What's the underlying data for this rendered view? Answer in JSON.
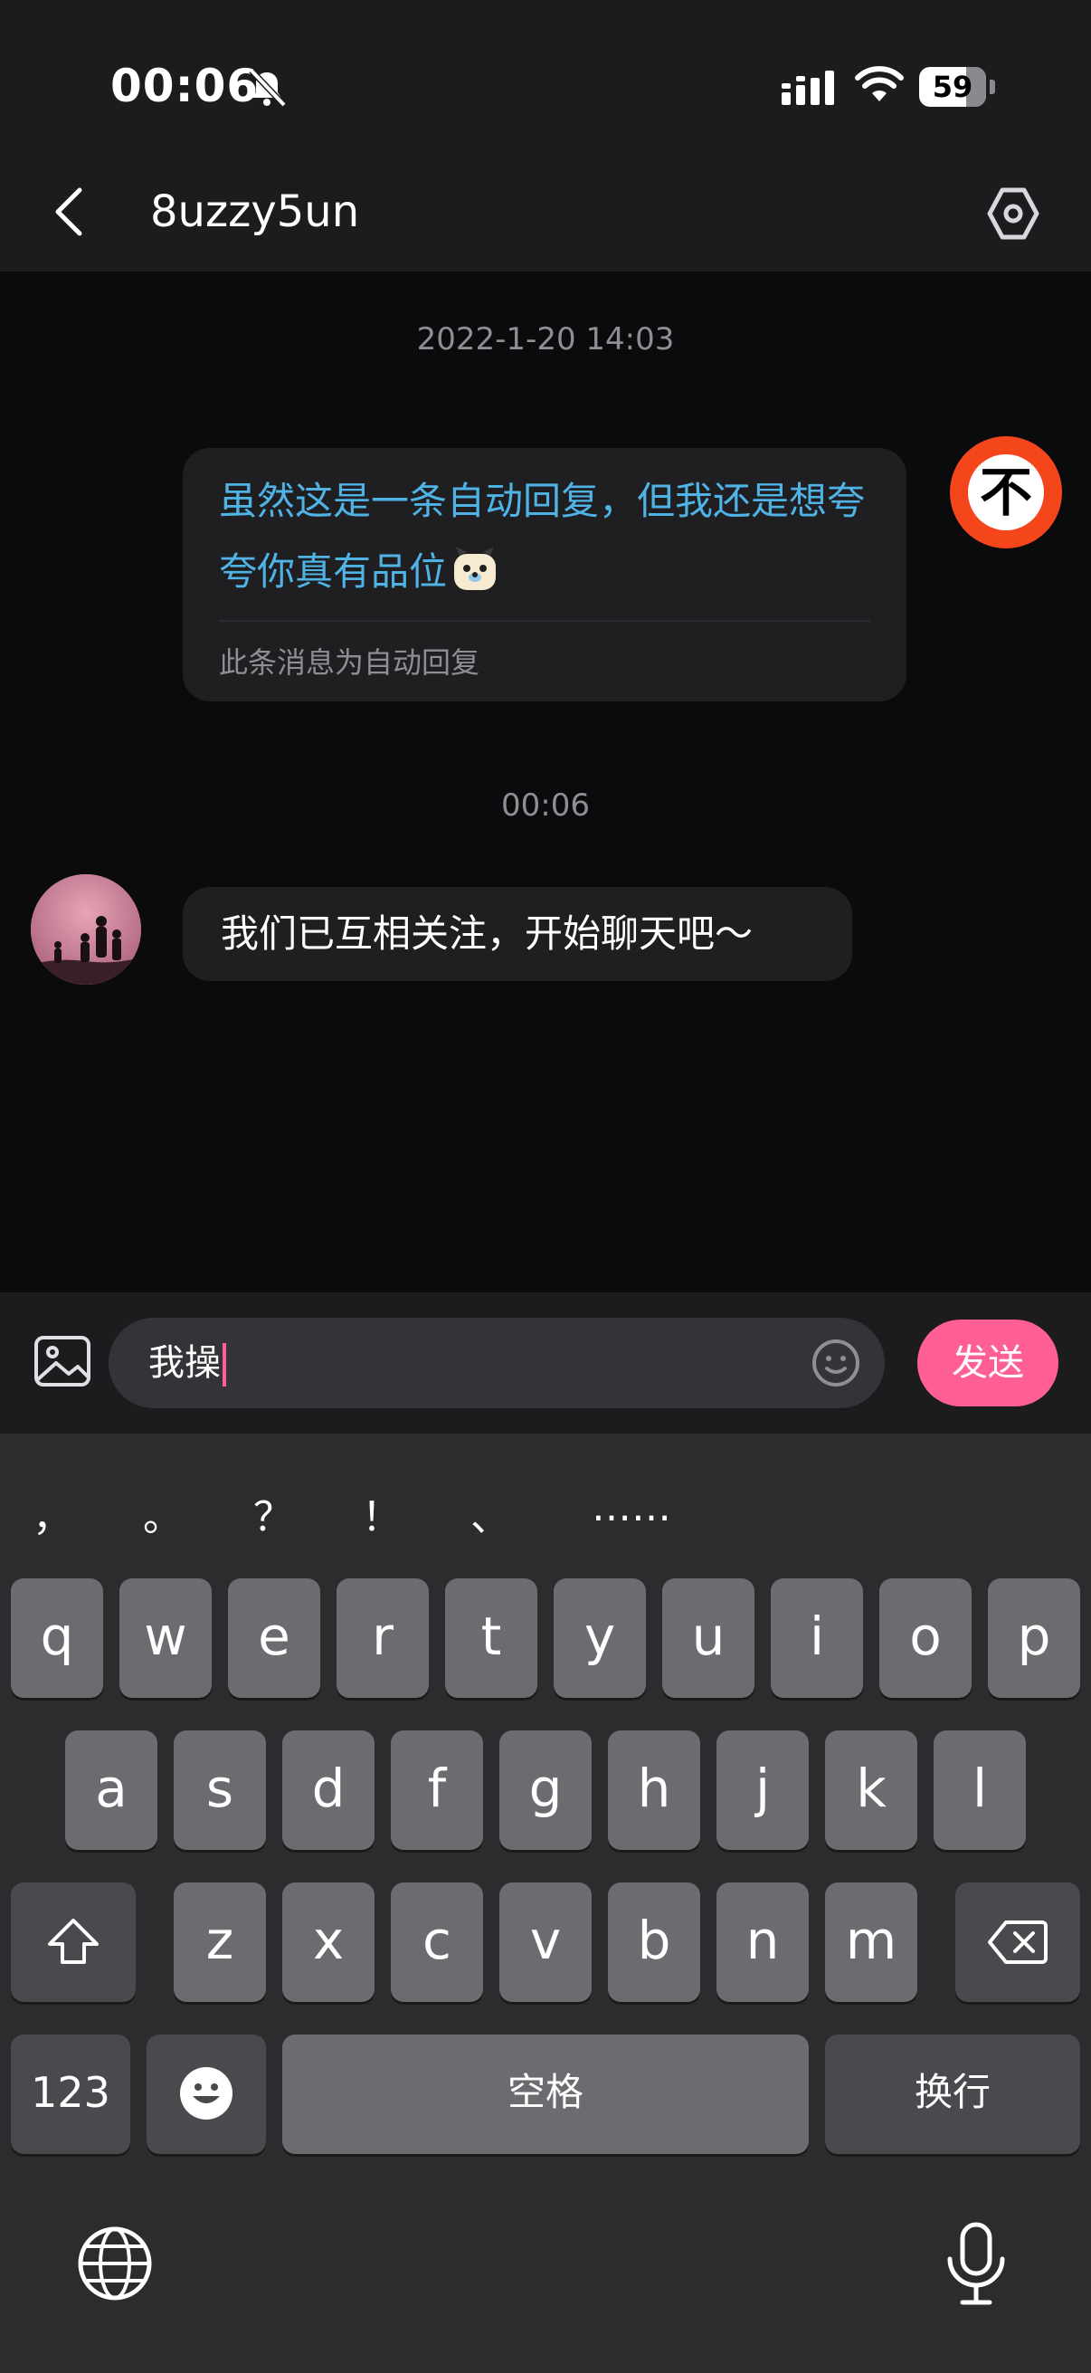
{
  "status_bar": {
    "time": "00:06",
    "battery": "59",
    "icons": [
      "bell-off-icon",
      "signal-icon",
      "wifi-icon",
      "battery-icon"
    ]
  },
  "header": {
    "title": "8uzzy5un",
    "back_icon": "chevron-left-icon",
    "settings_icon": "hexagon-settings-icon"
  },
  "chat": {
    "timestamp_1": "2022-1-20 14:03",
    "auto_reply": {
      "text": "虽然这是一条自动回复，但我还是想夸夸你真有品位",
      "note": "此条消息为自动回复",
      "emoji": "dog-face-icon"
    },
    "self_avatar_text": "不",
    "timestamp_2": "00:06",
    "other_message": "我们已互相关注，开始聊天吧～"
  },
  "input_bar": {
    "value": "我操",
    "send_label": "发送"
  },
  "keyboard": {
    "punctuation": [
      "，",
      "。",
      "？",
      "！",
      "、",
      "……"
    ],
    "row1": [
      "q",
      "w",
      "e",
      "r",
      "t",
      "y",
      "u",
      "i",
      "o",
      "p"
    ],
    "row2": [
      "a",
      "s",
      "d",
      "f",
      "g",
      "h",
      "j",
      "k",
      "l"
    ],
    "row3": [
      "z",
      "x",
      "c",
      "v",
      "b",
      "n",
      "m"
    ],
    "num_label": "123",
    "space_label": "空格",
    "return_label": "换行"
  },
  "colors": {
    "accent_pink": "#ff5f95",
    "auto_reply_blue": "#4fb3e6",
    "self_avatar_red": "#f4461a"
  }
}
